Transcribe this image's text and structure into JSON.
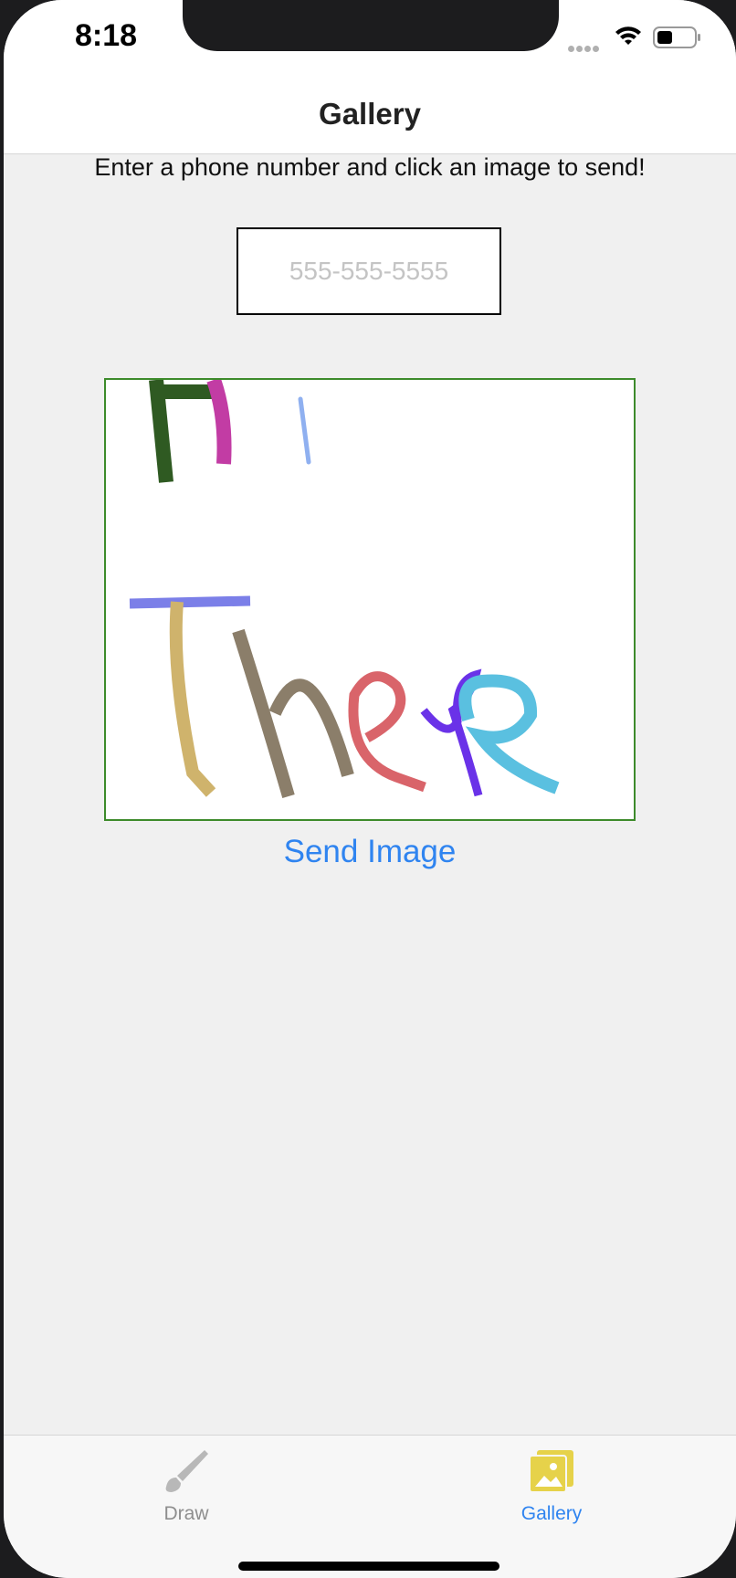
{
  "status_bar": {
    "time": "8:18"
  },
  "navbar": {
    "title": "Gallery"
  },
  "instructions": "Enter a phone number and click an image to send!",
  "phone_input": {
    "placeholder": "555-555-5555",
    "value": ""
  },
  "drawing": {
    "description_icon": "drawing-thumbnail"
  },
  "send_button": "Send Image",
  "tabs": [
    {
      "label": "Draw",
      "icon": "paintbrush-icon",
      "selected": false
    },
    {
      "label": "Gallery",
      "icon": "photos-icon",
      "selected": true
    }
  ],
  "colors": {
    "accent": "#2f84f0",
    "frame_border": "#3d8b2b",
    "gallery_icon": "#e6d24a"
  }
}
